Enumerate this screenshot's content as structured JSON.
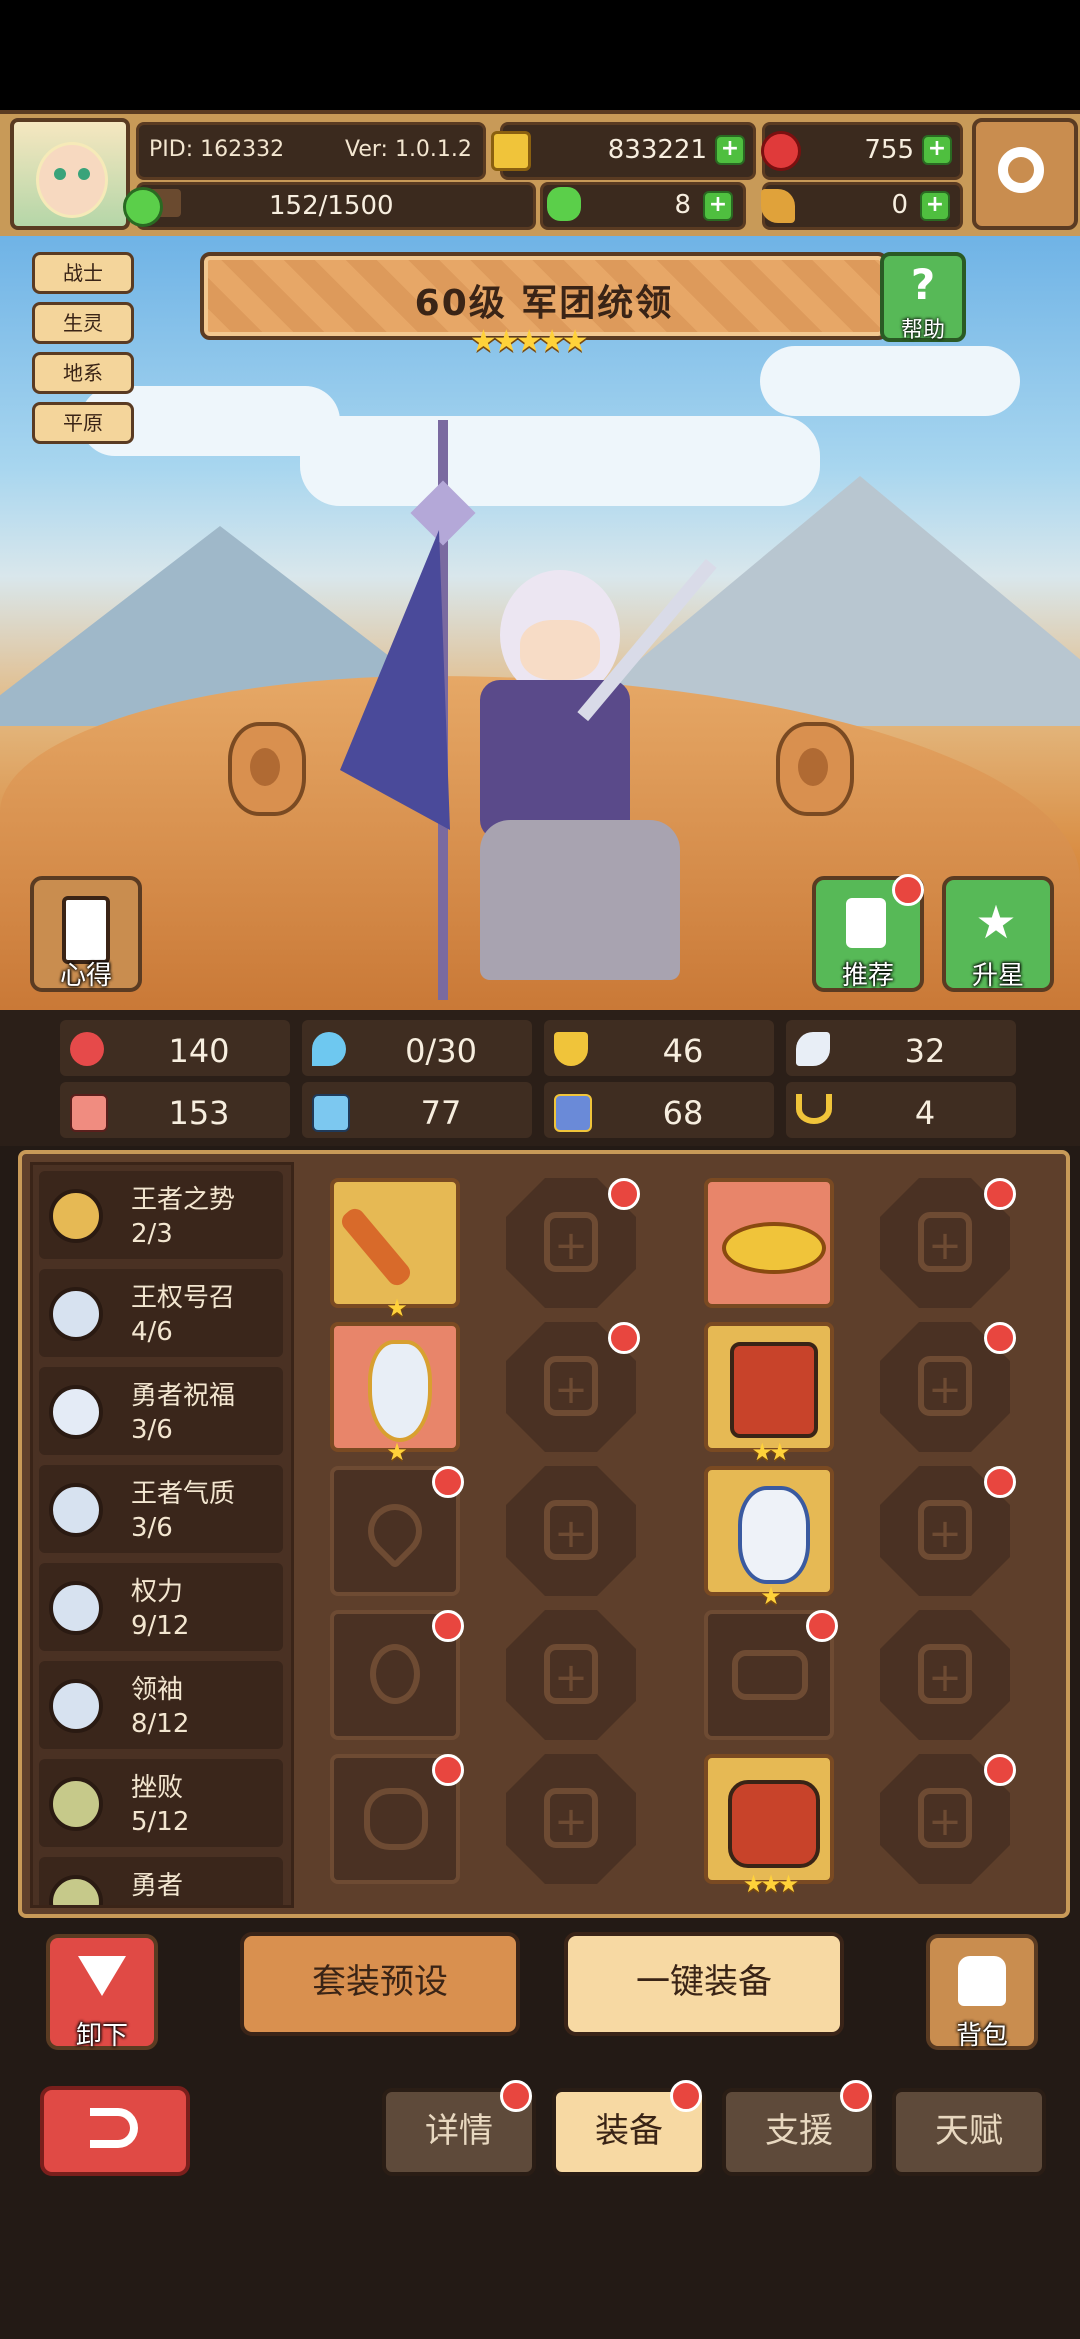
{
  "header": {
    "pid": "PID: 162332",
    "version": "Ver: 1.0.1.2",
    "gold": "833221",
    "gems": "755",
    "xp": "152/1500",
    "xp_fraction": 0.101,
    "clover": "8",
    "keys": "0"
  },
  "hero": {
    "tags": [
      "战士",
      "生灵",
      "地系",
      "平原"
    ],
    "title": "60级  军团统领",
    "stars": "★★★★★",
    "help_label": "帮助",
    "insight_label": "心得",
    "recommend_label": "推荐",
    "upgrade_label": "升星"
  },
  "stats": {
    "hp": "140",
    "mana": "0/30",
    "defense": "46",
    "speed": "32",
    "attack": "153",
    "magic": "77",
    "agility": "68",
    "luck": "4"
  },
  "skills": [
    {
      "name": "王者之势",
      "progress": "2/3"
    },
    {
      "name": "王权号召",
      "progress": "4/6"
    },
    {
      "name": "勇者祝福",
      "progress": "3/6"
    },
    {
      "name": "王者气质",
      "progress": "3/6"
    },
    {
      "name": "权力",
      "progress": "9/12"
    },
    {
      "name": "领袖",
      "progress": "8/12"
    },
    {
      "name": "挫败",
      "progress": "5/12"
    },
    {
      "name": "勇者",
      "progress": ""
    }
  ],
  "actions": {
    "unequip": "卸下",
    "preset": "套装预设",
    "auto_equip": "一键装备",
    "bag": "背包"
  },
  "nav": {
    "details": "详情",
    "equipment": "装备",
    "support": "支援",
    "talent": "天赋"
  },
  "colors": {
    "accent_gold": "#c89a58",
    "panel_brown": "#5e3f2b",
    "badge_red": "#e8463f",
    "plus_green": "#4fbf3f"
  }
}
